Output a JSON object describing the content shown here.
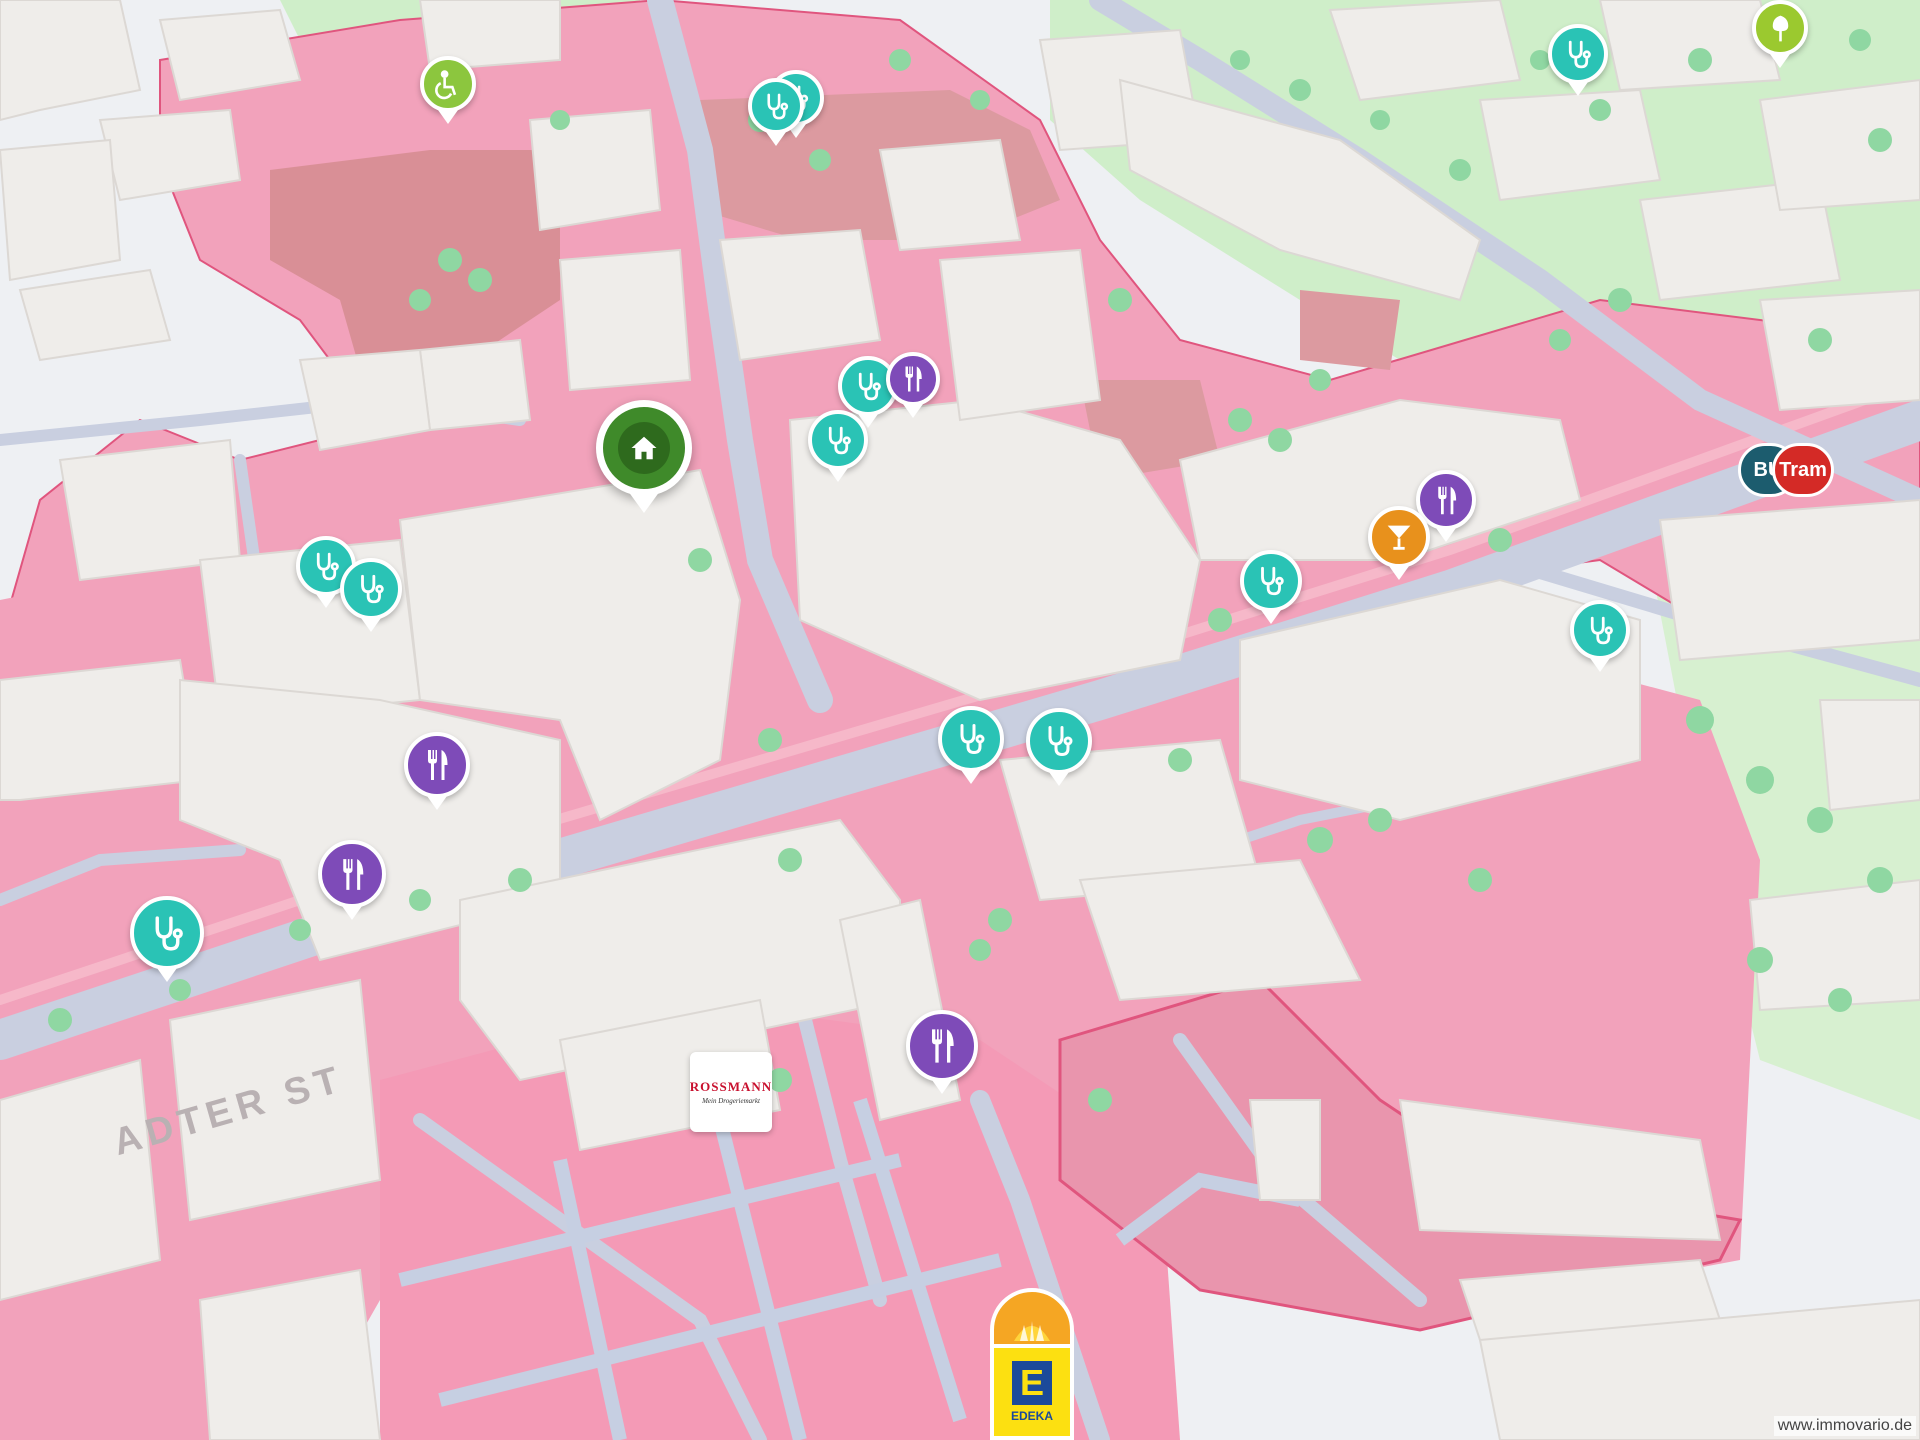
{
  "map": {
    "street_label": "ADTER ST",
    "attribution": "www.immovario.de",
    "colors": {
      "background": "#eef0f3",
      "zone_pink": "#f2a2bb",
      "zone_dark": "#d98f96",
      "park_green": "#cfeec9",
      "road": "#c9cfe0",
      "building": "#efedea",
      "zone_border": "#e0557e"
    }
  },
  "markers": {
    "home": {
      "icon": "house-icon",
      "color": "#3f8a2a"
    },
    "doctor": {
      "icon": "stethoscope-icon",
      "color": "#2ac3b5",
      "count": 12
    },
    "restaurant": {
      "icon": "fork-knife-icon",
      "color": "#7e4bb8",
      "count": 5
    },
    "bar": {
      "icon": "cocktail-icon",
      "color": "#e8911c"
    },
    "wheelchair": {
      "icon": "wheelchair-icon",
      "color": "#8cc63e"
    },
    "park": {
      "icon": "tree-icon",
      "color": "#9bc92f"
    }
  },
  "transit": {
    "bus_label": "BU",
    "tram_label": "Tram",
    "bus_color": "#1c5c6e",
    "tram_color": "#d42a26"
  },
  "stores": {
    "rossmann": {
      "name": "ROSSMANN",
      "tagline": "Mein Drogeriemarkt",
      "color": "#c8102e"
    },
    "edeka": {
      "name": "EDEKA",
      "color": "#fce011",
      "top_color": "#f5a623"
    }
  }
}
